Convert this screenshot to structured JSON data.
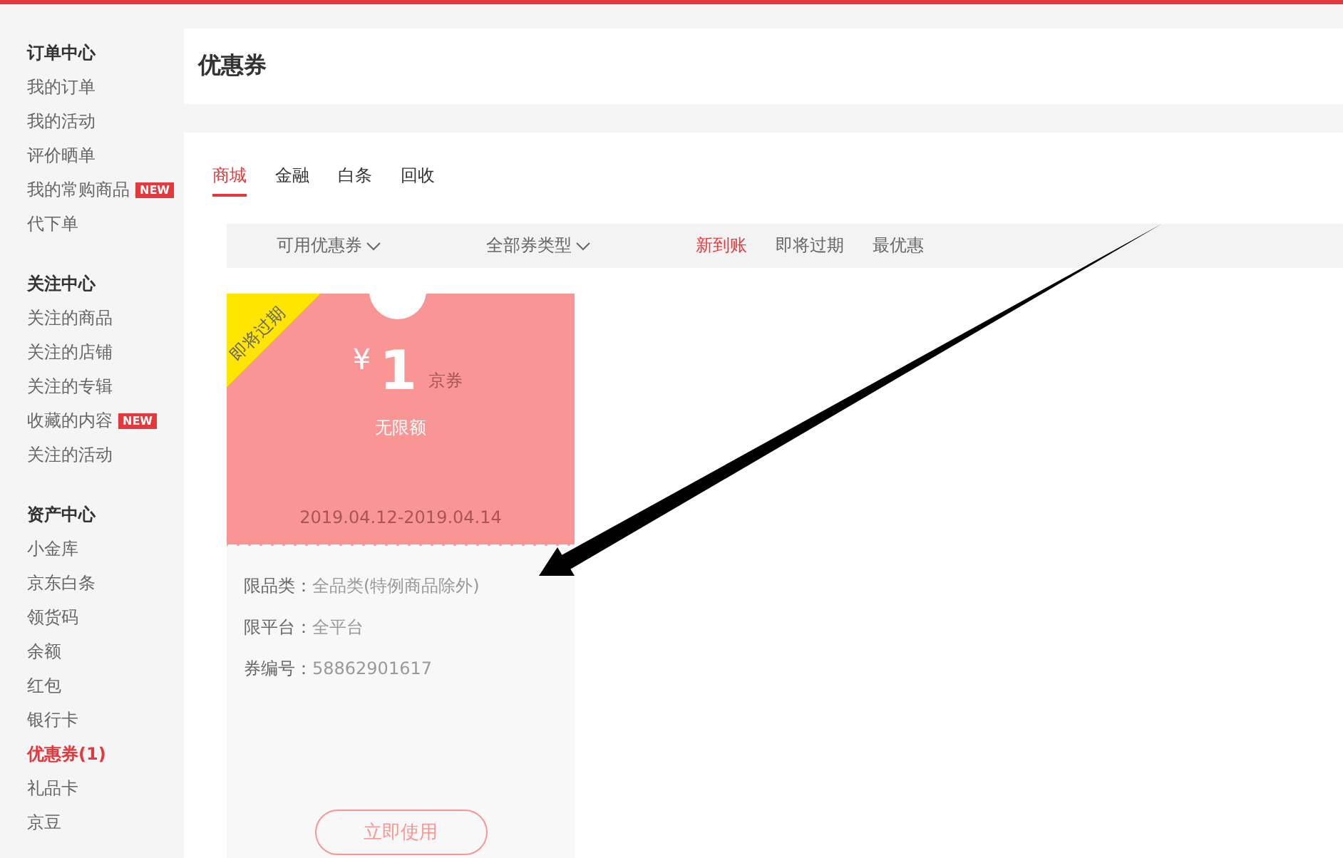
{
  "sidebar": {
    "sections": [
      {
        "title": "订单中心",
        "items": [
          {
            "label": "我的订单",
            "selected": false
          },
          {
            "label": "我的活动",
            "selected": false
          },
          {
            "label": "评价晒单",
            "selected": false
          },
          {
            "label": "我的常购商品",
            "selected": false,
            "badge": "NEW"
          },
          {
            "label": "代下单",
            "selected": false
          }
        ]
      },
      {
        "title": "关注中心",
        "items": [
          {
            "label": "关注的商品",
            "selected": false
          },
          {
            "label": "关注的店铺",
            "selected": false
          },
          {
            "label": "关注的专辑",
            "selected": false
          },
          {
            "label": "收藏的内容",
            "selected": false,
            "badge": "NEW"
          },
          {
            "label": "关注的活动",
            "selected": false
          }
        ]
      },
      {
        "title": "资产中心",
        "items": [
          {
            "label": "小金库",
            "selected": false
          },
          {
            "label": "京东白条",
            "selected": false
          },
          {
            "label": "领货码",
            "selected": false
          },
          {
            "label": "余额",
            "selected": false
          },
          {
            "label": "红包",
            "selected": false
          },
          {
            "label": "银行卡",
            "selected": false
          },
          {
            "label": "优惠券(1)",
            "selected": true
          },
          {
            "label": "礼品卡",
            "selected": false
          },
          {
            "label": "京豆",
            "selected": false
          }
        ]
      }
    ]
  },
  "page_title": "优惠券",
  "tabs": [
    {
      "label": "商城",
      "selected": true
    },
    {
      "label": "金融",
      "selected": false
    },
    {
      "label": "白条",
      "selected": false
    },
    {
      "label": "回收",
      "selected": false
    }
  ],
  "filters": [
    {
      "kind": "dropdown",
      "label": "可用优惠券",
      "selected": false
    },
    {
      "kind": "dropdown",
      "label": "全部券类型",
      "selected": false
    },
    {
      "kind": "sort",
      "label": "新到账",
      "selected": true
    },
    {
      "kind": "sort",
      "label": "即将过期",
      "selected": false
    },
    {
      "kind": "sort",
      "label": "最优惠",
      "selected": false
    }
  ],
  "coupons": [
    {
      "tag": "即将过期",
      "currency": "¥",
      "amount": "1",
      "unit": "京券",
      "limit": "无限额",
      "validity": "2019.04.12-2019.04.14",
      "details": [
        {
          "label": "限品类：",
          "value": "全品类(特例商品除外)"
        },
        {
          "label": "限平台：",
          "value": "全平台"
        },
        {
          "label": "券编号：",
          "value": "58862901617"
        }
      ],
      "button": "立即使用"
    }
  ]
}
